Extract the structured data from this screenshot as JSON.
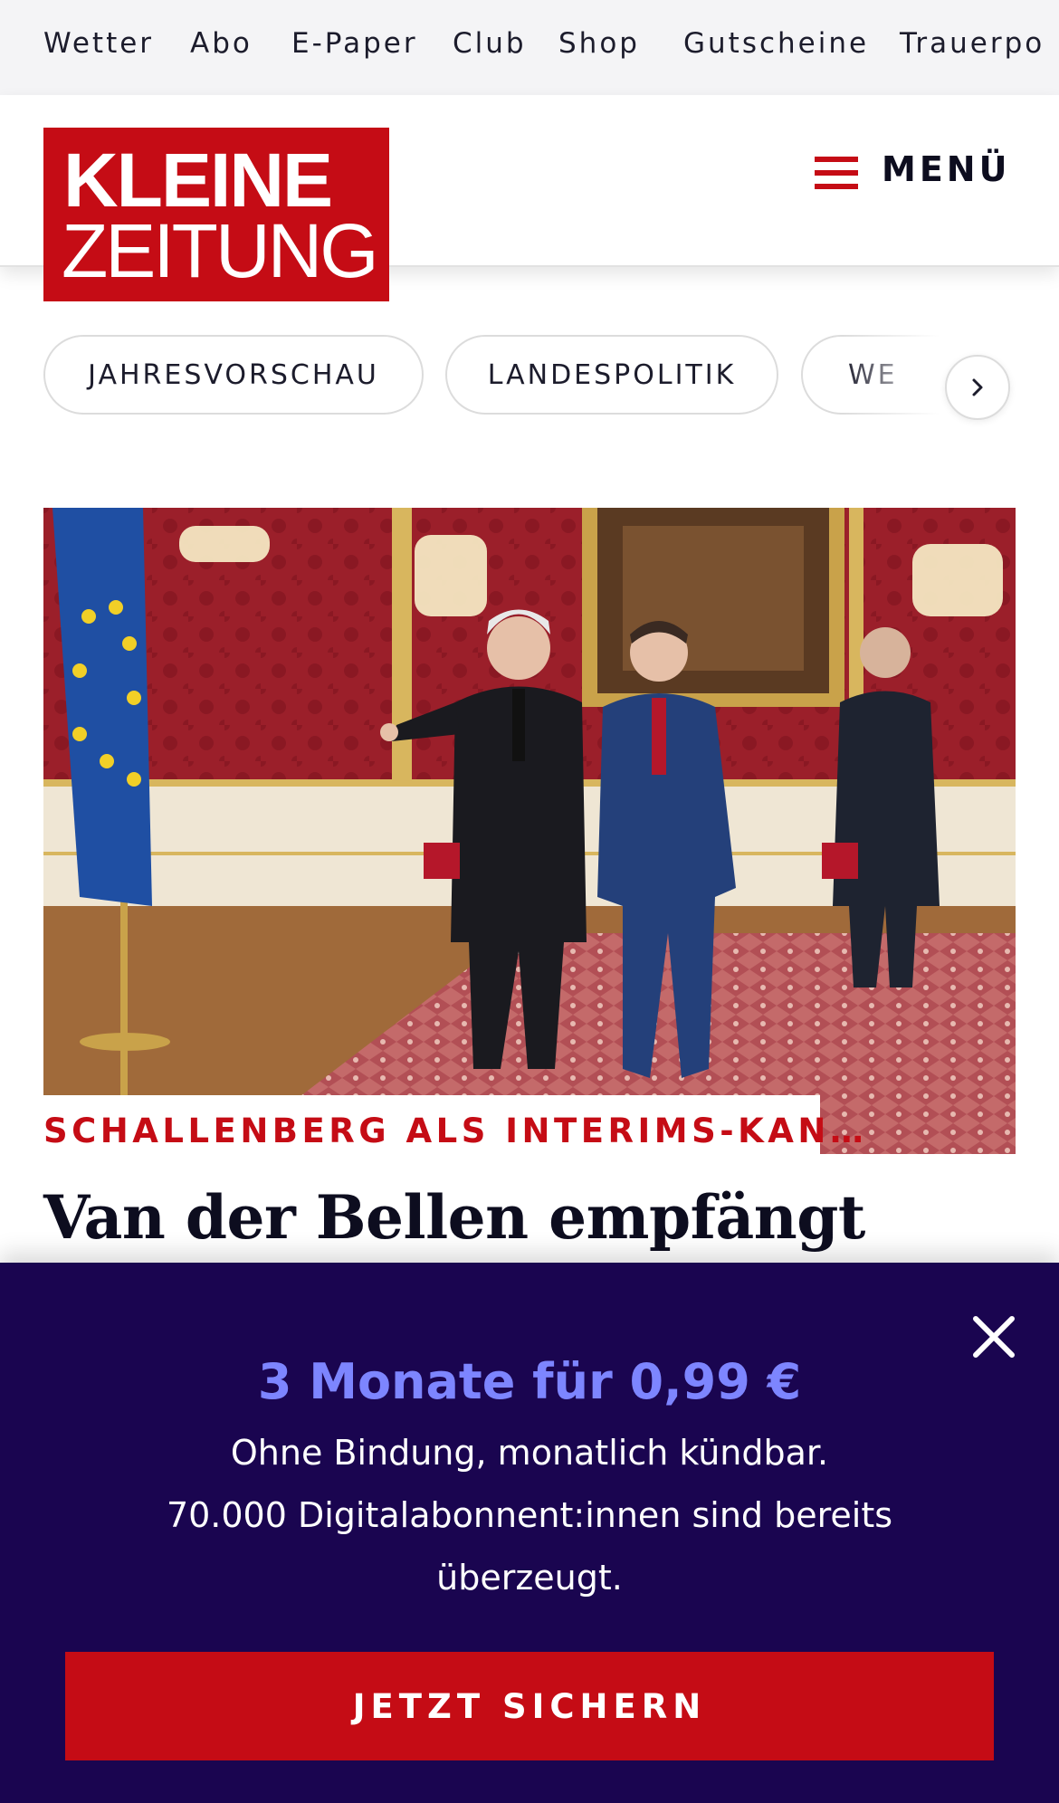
{
  "topnav": {
    "items": [
      "Wetter",
      "Abo",
      "E-Paper",
      "Club",
      "Shop",
      "Gutscheine",
      "Trauerpo"
    ]
  },
  "header": {
    "logo": {
      "line1": "KLEINE",
      "line2": "ZEITUNG"
    },
    "menu_label": "MENÜ"
  },
  "topics": {
    "chips": [
      "JAHRESVORSCHAU",
      "LANDESPOLITIK",
      "WE"
    ],
    "next_icon": "chevron-right-icon"
  },
  "article": {
    "image_icon": "photo-hofburg-reception",
    "kicker": "SCHALLENBERG ALS INTERIMS-KAN…",
    "headline": "Van der Bellen empfängt"
  },
  "paywall": {
    "title": "3 Monate für 0,99 €",
    "line1": "Ohne Bindung, monatlich kündbar.",
    "line2": "70.000 Digitalabonnent:innen sind bereits überzeugt.",
    "cta_label": "JETZT SICHERN",
    "close_icon": "close-icon"
  },
  "colors": {
    "brand_red": "#c50c15",
    "paywall_bg": "#1a0550",
    "offer_accent": "#7d85ff"
  }
}
